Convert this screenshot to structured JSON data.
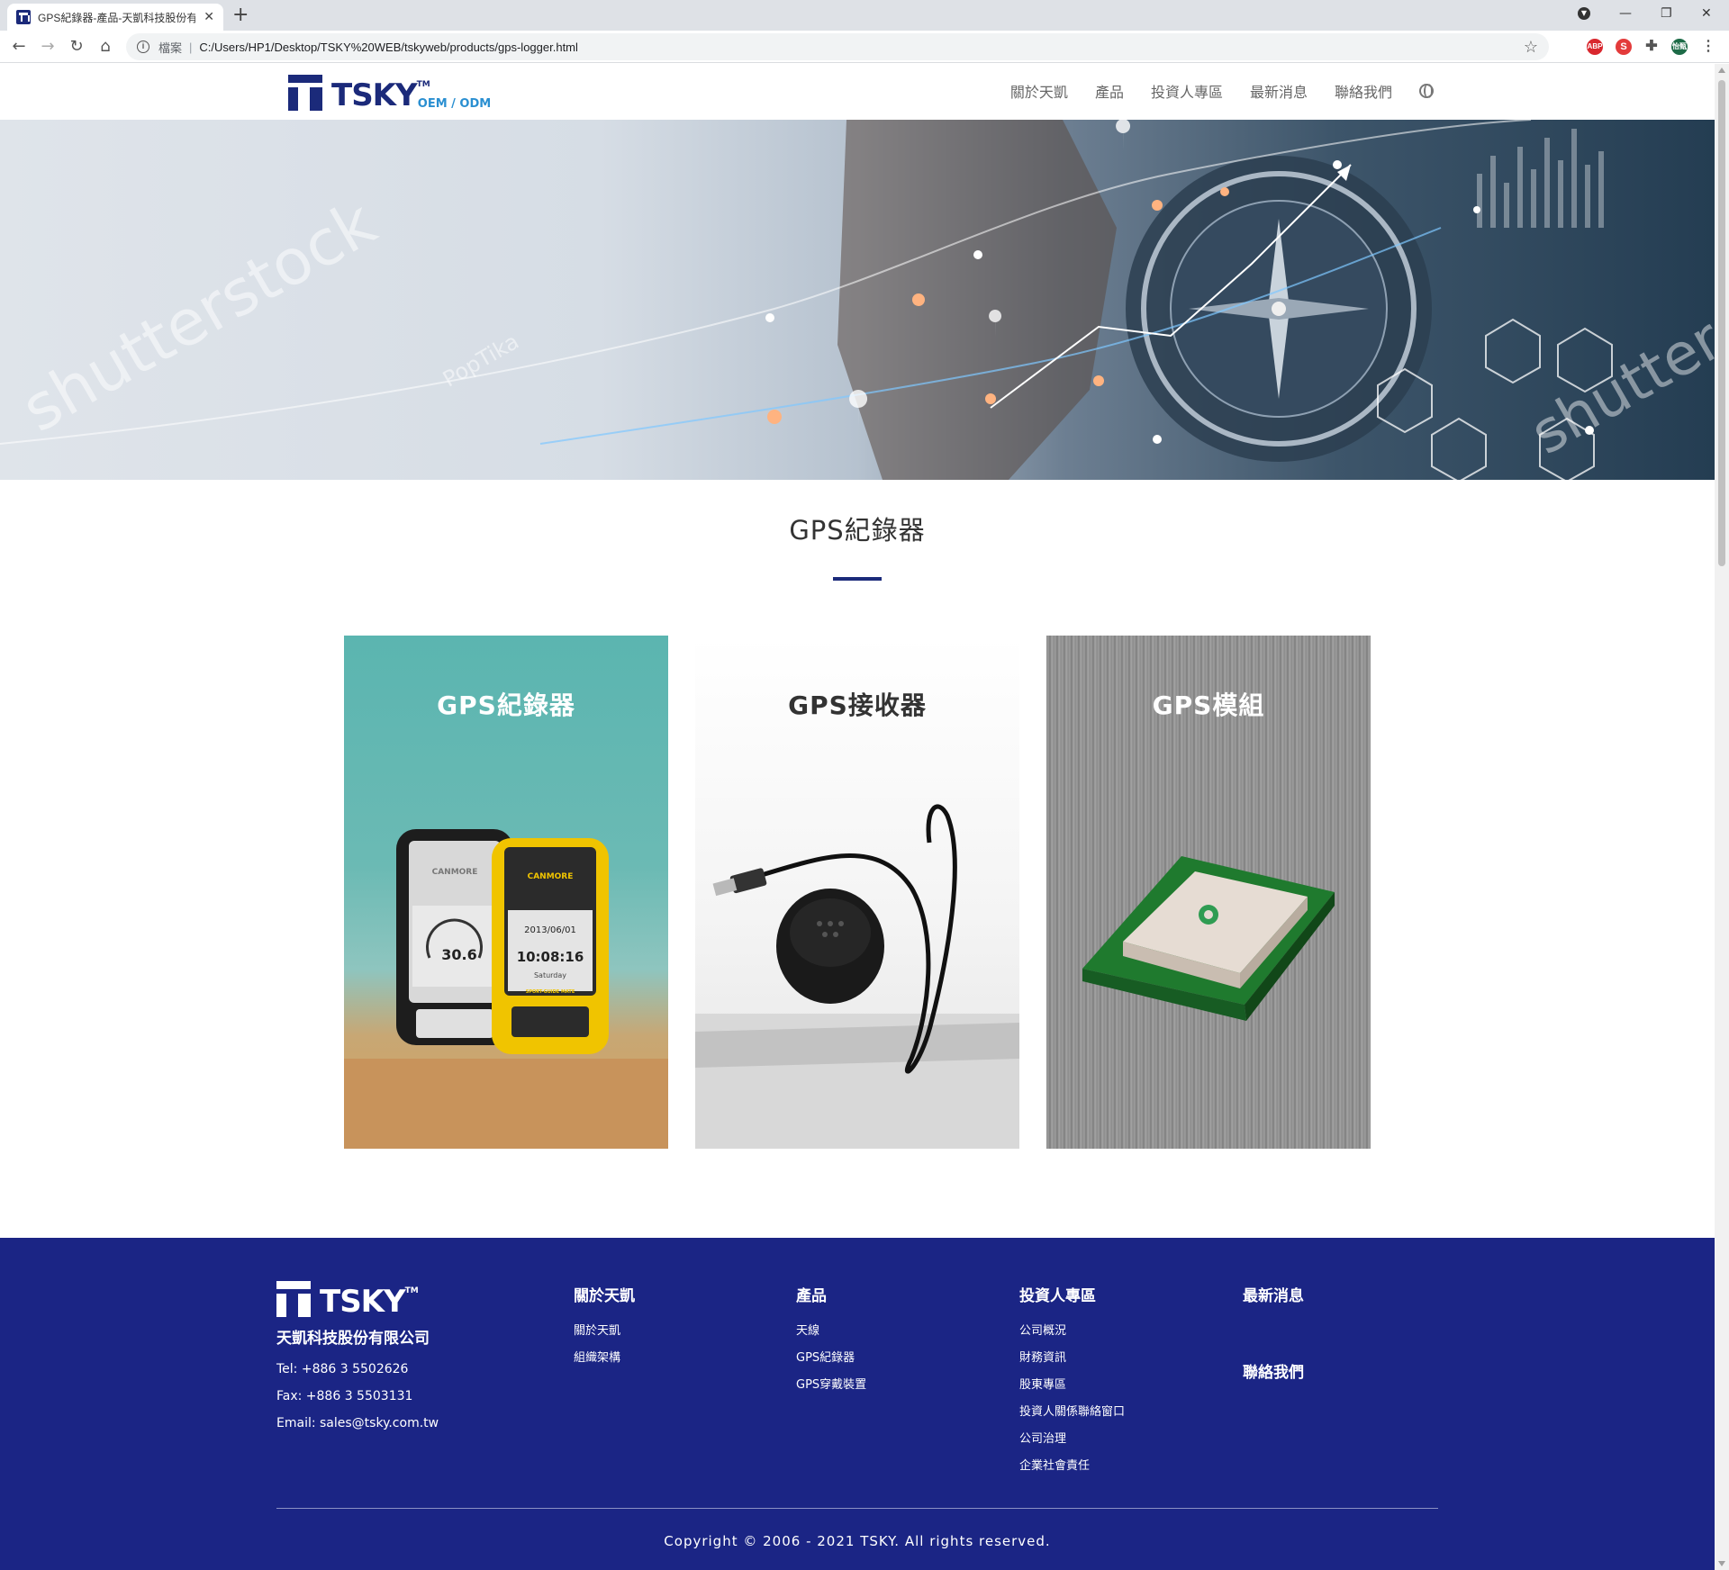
{
  "browser": {
    "tab_title": "GPS紀錄器-產品-天凱科技股份有限公司",
    "file_label": "檔案",
    "url": "C:/Users/HP1/Desktop/TSKY%20WEB/tskyweb/products/gps-logger.html",
    "ext_abp": "ABP",
    "ext_s": "S",
    "profile": "怡甄"
  },
  "header": {
    "logo_text": "TSKY",
    "logo_tm": "TM",
    "logo_sub": "OEM / ODM",
    "nav": [
      "關於天凱",
      "產品",
      "投資人專區",
      "最新消息",
      "聯絡我們"
    ]
  },
  "hero": {
    "watermarks": [
      "shutterstock",
      "PopTika",
      "shutterst"
    ]
  },
  "main": {
    "title": "GPS紀錄器",
    "cards": [
      {
        "title": "GPS紀錄器"
      },
      {
        "title": "GPS接收器"
      },
      {
        "title": "GPS模組"
      }
    ],
    "device_text": {
      "brand": "CANMORE",
      "speed": "30.6",
      "date": "2013/06/01",
      "time": "10:08:16",
      "day": "Saturday",
      "label": "SPORT-GUIDE MATE"
    }
  },
  "footer": {
    "logo_text": "TSKY",
    "logo_tm": "TM",
    "company": "天凱科技股份有限公司",
    "tel": "Tel: +886 3 5502626",
    "fax": "Fax: +886 3 5503131",
    "email": "Email: sales@tsky.com.tw",
    "cols": [
      {
        "heading": "關於天凱",
        "links": [
          "關於天凱",
          "組織架構"
        ]
      },
      {
        "heading": "產品",
        "links": [
          "天線",
          "GPS紀錄器",
          "GPS穿戴裝置"
        ]
      },
      {
        "heading": "投資人專區",
        "links": [
          "公司概況",
          "財務資訊",
          "股東專區",
          "投資人關係聯絡窗口",
          "公司治理",
          "企業社會責任"
        ]
      },
      {
        "heading": "最新消息",
        "links": []
      }
    ],
    "contact_heading": "聯絡我們",
    "copyright": "Copyright © 2006 - 2021 TSKY. All rights reserved."
  },
  "colors": {
    "brand_navy": "#1b2a7a",
    "footer_bg": "#1b2585",
    "accent_blue": "#2a8fd1"
  }
}
